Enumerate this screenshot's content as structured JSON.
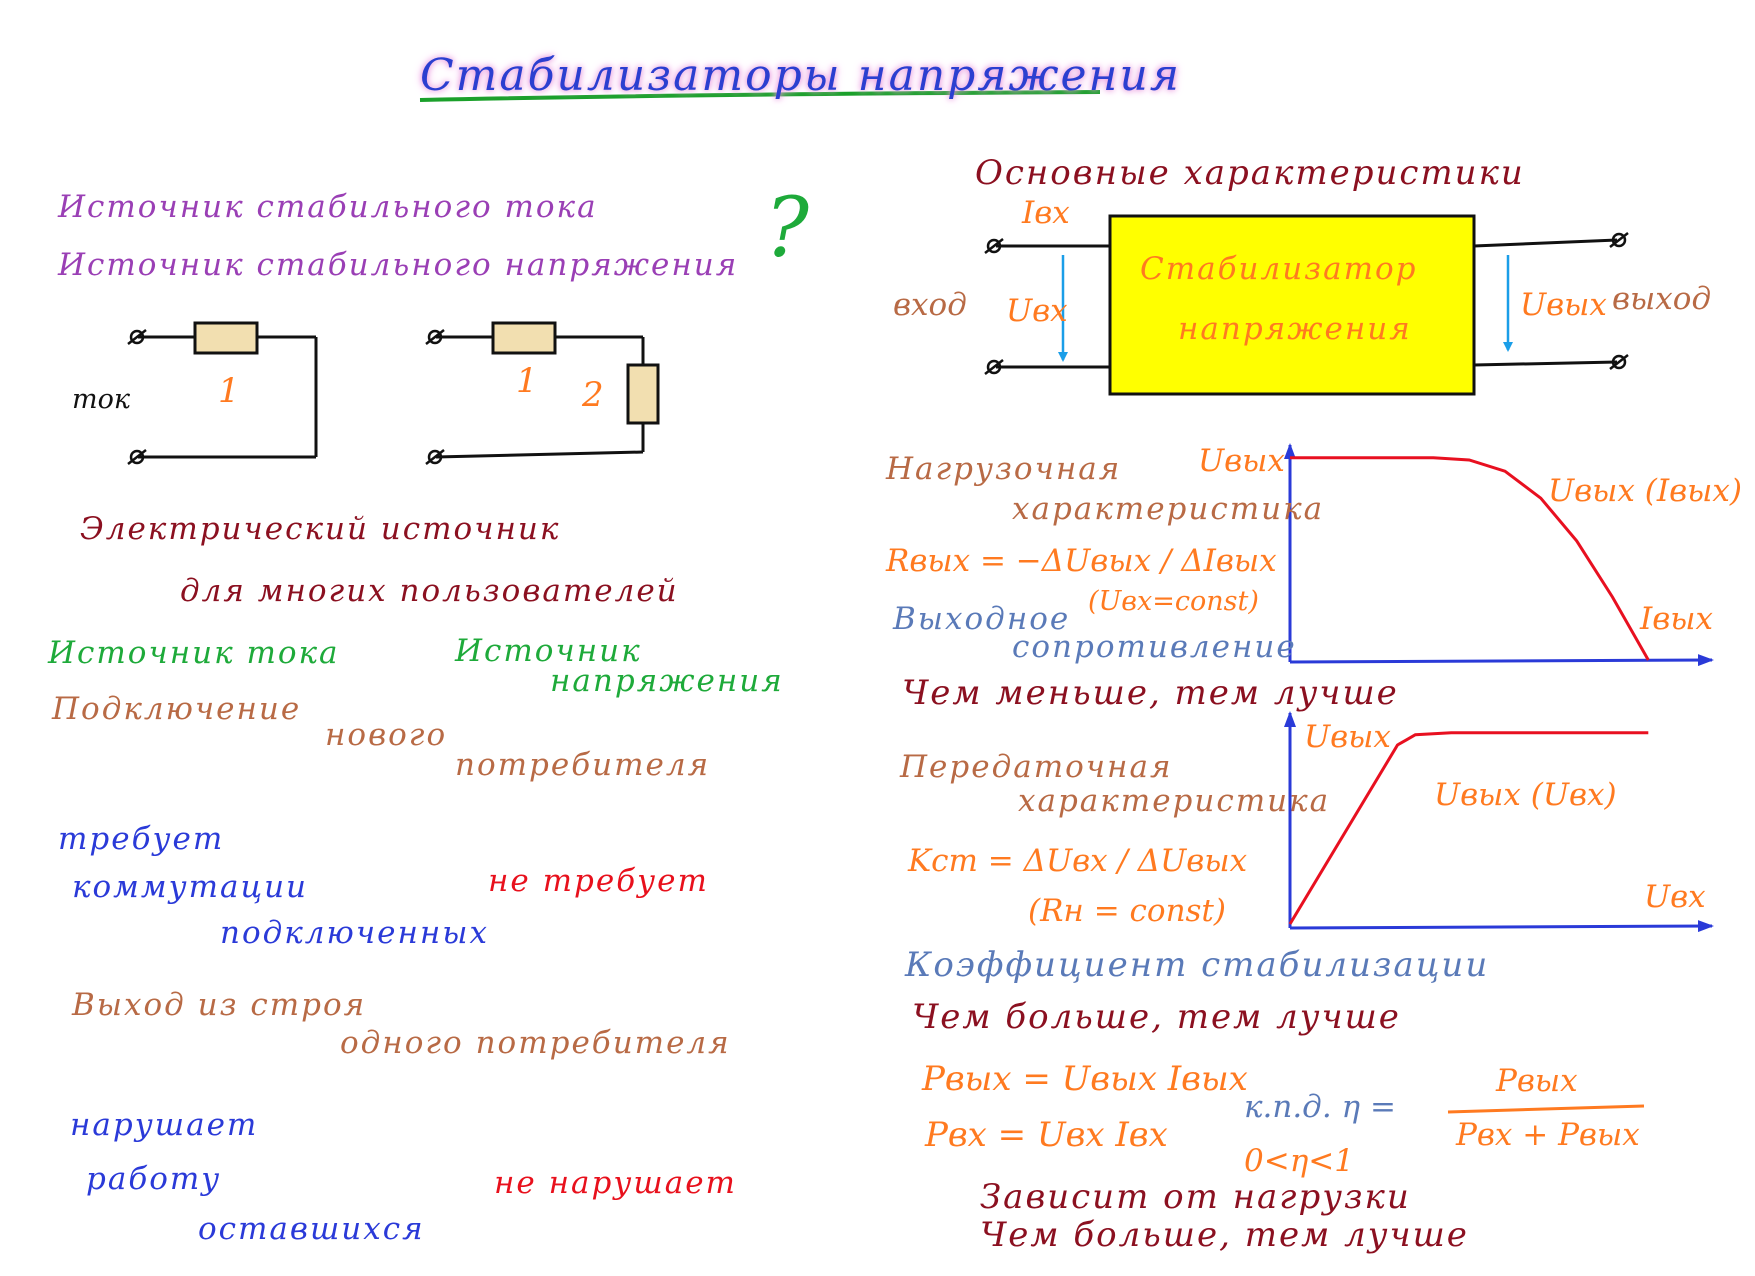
{
  "colors": {
    "title": "#2b3fd0",
    "title_underline": "#1aa02a",
    "purple": "#9a3fb5",
    "green": "#1eaa3a",
    "maroon": "#8b1020",
    "brown": "#b86a45",
    "blue": "#2a3ad8",
    "red": "#e8101c",
    "orange": "#ff7a20",
    "steel": "#5a7ab8",
    "box_fill": "#ffff00",
    "curve": "#e81020",
    "axis": "#2a3ad8",
    "arrow": "#1a9ee8"
  },
  "title": "Стабилизаторы напряжения",
  "left": {
    "q1": "Источник стабильного тока",
    "q2": "Источник стабильного напряжения",
    "qmark": "?",
    "circuit1": {
      "side_label": "ток",
      "resistor_label": "1"
    },
    "circuit2": {
      "r1_label": "1",
      "r2_label": "2"
    },
    "line1": "Электрический источник",
    "line2": "для многих пользователей",
    "col_current": "Источник тока",
    "col_voltage_1": "Источник",
    "col_voltage_2": "напряжения",
    "connect_1": "Подключение",
    "connect_2": "нового",
    "connect_3": "потребителя",
    "req_1": "требует",
    "req_2": "коммутации",
    "req_3": "подключенных",
    "req_not": "не требует",
    "fail_1": "Выход из строя",
    "fail_2": "одного потребителя",
    "break_1": "нарушает",
    "break_2": "работу",
    "break_3": "оставшихся",
    "break_not": "не нарушает"
  },
  "right": {
    "heading": "Основные характеристики",
    "in_label": "вход",
    "out_label": "выход",
    "box_line1": "Стабилизатор",
    "box_line2": "напряжения",
    "i_in": "Iвх",
    "u_in": "Uвх",
    "u_out": "Uвых",
    "load_1": "Нагрузочная",
    "load_2": "характеристика",
    "r_out": "Rвых = −ΔUвых / ΔIвых",
    "u_const": "(Uвх=const)",
    "out_res_1": "Выходное",
    "out_res_2": "сопротивление",
    "less_better": "Чем меньше, тем лучше",
    "transfer_1": "Передаточная",
    "transfer_2": "характеристика",
    "k_st": "Kст = ΔUвх / ΔUвых",
    "r_const": "(Rн = const)",
    "coef": "Коэффициент стабилизации",
    "more_better_1": "Чем больше, тем лучше",
    "p_out": "Pвых = Uвых Iвых",
    "p_in": "Pвх = Uвх Iвх",
    "eff_label": "к.п.д. η =",
    "eff_num": "Pвых",
    "eff_den": "Pвх + Pвых",
    "eff_range": "0<η<1",
    "depends": "Зависит от нагрузки",
    "more_better_2": "Чем больше, тем лучше"
  },
  "chart_data": [
    {
      "type": "line",
      "title": "",
      "ylabel": "Uвых",
      "xlabel": "Iвых",
      "series": [
        {
          "name": "Uвых (Iвых)",
          "x": [
            0,
            0.2,
            0.4,
            0.5,
            0.6,
            0.7,
            0.8,
            0.9,
            1.0
          ],
          "y": [
            0.9,
            0.9,
            0.9,
            0.89,
            0.84,
            0.72,
            0.53,
            0.28,
            0.0
          ]
        }
      ],
      "xlim": [
        0,
        1.2
      ],
      "ylim": [
        0,
        1.05
      ],
      "grid": false
    },
    {
      "type": "line",
      "title": "",
      "ylabel": "Uвых",
      "xlabel": "Uвх",
      "series": [
        {
          "name": "Uвых (Uвх)",
          "x": [
            0,
            0.3,
            0.35,
            0.45,
            1.0
          ],
          "y": [
            0.0,
            0.87,
            0.92,
            0.93,
            0.93
          ]
        }
      ],
      "xlim": [
        0,
        1.2
      ],
      "ylim": [
        0,
        1.05
      ],
      "grid": false
    }
  ]
}
